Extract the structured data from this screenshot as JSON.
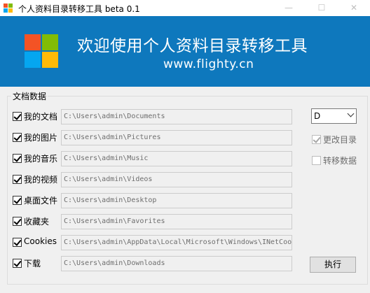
{
  "window": {
    "title": "个人资料目录转移工具 beta 0.1",
    "minimize_glyph": "—",
    "maximize_glyph": "☐",
    "close_glyph": "✕"
  },
  "banner": {
    "title": "欢迎使用个人资料目录转移工具",
    "url": "www.flighty.cn",
    "background": "#0e78bd",
    "logo_colors": [
      "#f35325",
      "#81bc06",
      "#05a6f0",
      "#ffba08"
    ]
  },
  "group": {
    "title": "文档数据"
  },
  "folders": [
    {
      "label": "我的文档",
      "checked": true,
      "path": "C:\\Users\\admin\\Documents"
    },
    {
      "label": "我的图片",
      "checked": true,
      "path": "C:\\Users\\admin\\Pictures"
    },
    {
      "label": "我的音乐",
      "checked": true,
      "path": "C:\\Users\\admin\\Music"
    },
    {
      "label": "我的视频",
      "checked": true,
      "path": "C:\\Users\\admin\\Videos"
    },
    {
      "label": "桌面文件",
      "checked": true,
      "path": "C:\\Users\\admin\\Desktop"
    },
    {
      "label": "收藏夹",
      "checked": true,
      "path": "C:\\Users\\admin\\Favorites"
    },
    {
      "label": "Cookies",
      "checked": true,
      "path": "C:\\Users\\admin\\AppData\\Local\\Microsoft\\Windows\\INetCookies"
    },
    {
      "label": "下载",
      "checked": true,
      "path": "C:\\Users\\admin\\Downloads"
    }
  ],
  "options": {
    "drive_selected": "D",
    "change_dir_label": "更改目录",
    "change_dir_checked": true,
    "move_data_label": "转移数据",
    "move_data_checked": false
  },
  "execute_label": "执行"
}
